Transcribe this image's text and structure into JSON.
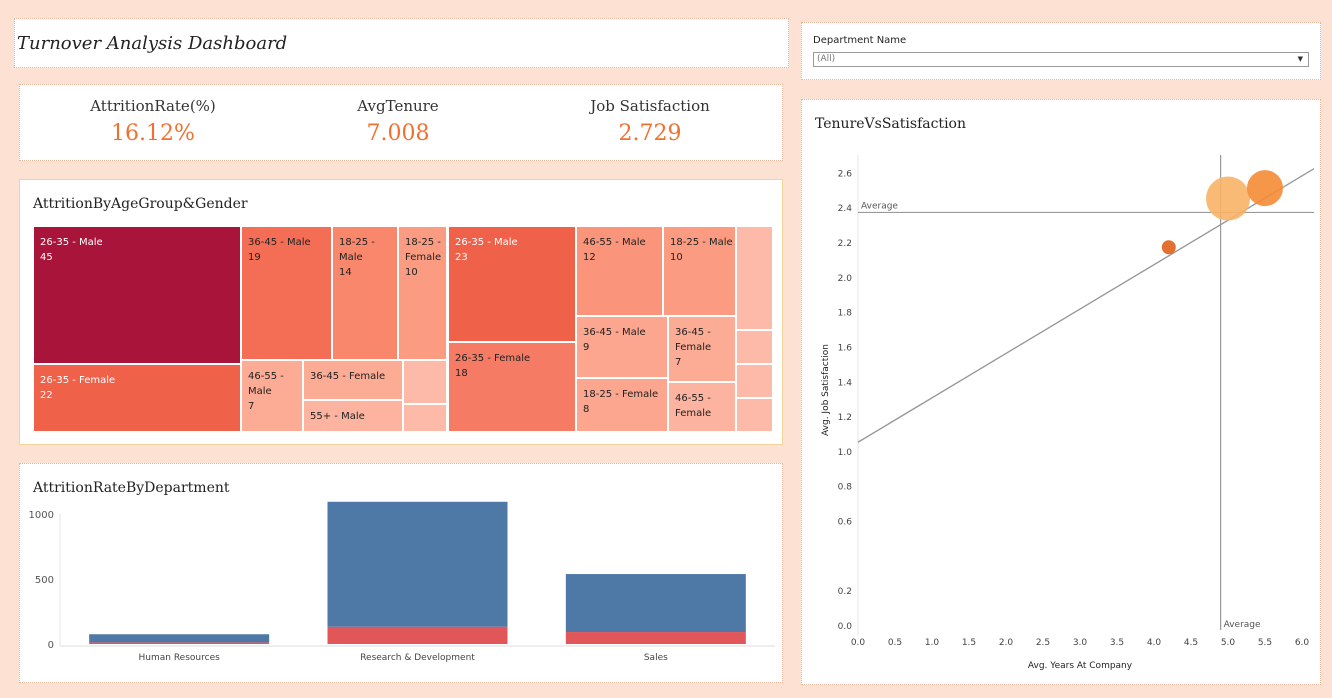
{
  "header": {
    "title": "Turnover Analysis Dashboard"
  },
  "filter": {
    "label": "Department Name",
    "value": "(All)"
  },
  "kpis": [
    {
      "label": "AttritionRate(%)",
      "value": "16.12%"
    },
    {
      "label": "AvgTenure",
      "value": "7.008"
    },
    {
      "label": "Job Satisfaction",
      "value": "2.729"
    }
  ],
  "treemap": {
    "title": "AttritionByAgeGroup&Gender",
    "cells": [
      {
        "label": "26-35 - Male",
        "value": "45",
        "color": "#a8143a"
      },
      {
        "label": "26-35 - Female",
        "value": "22",
        "color": "#f0614a"
      },
      {
        "label": "36-45 - Male",
        "value": "19",
        "color": "#f46d55"
      },
      {
        "label": "18-25 - Male",
        "value": "14",
        "color": "#f8876c"
      },
      {
        "label": "18-25 - Female",
        "value": "10",
        "color": "#fb9c82"
      },
      {
        "label": "46-55 - Male",
        "value": "7",
        "color": "#fcab95"
      },
      {
        "label": "36-45 - Female",
        "value": "",
        "color": "#fcab95"
      },
      {
        "label": "55+ - Male",
        "value": "",
        "color": "#fcb3a0"
      },
      {
        "label": "26-35 - Male",
        "value": "23",
        "color": "#f0614a"
      },
      {
        "label": "26-35 - Female",
        "value": "18",
        "color": "#f67b64"
      },
      {
        "label": "46-55 - Male",
        "value": "12",
        "color": "#fa957c"
      },
      {
        "label": "18-25 - Male",
        "value": "10",
        "color": "#fb9c82"
      },
      {
        "label": "36-45 - Male",
        "value": "9",
        "color": "#fca68f"
      },
      {
        "label": "36-45 - Female",
        "value": "7",
        "color": "#fcab95"
      },
      {
        "label": "18-25 - Female",
        "value": "8",
        "color": "#fca68f"
      },
      {
        "label": "46-55 - Female",
        "value": "",
        "color": "#fcb3a0"
      }
    ]
  },
  "chart_data": [
    {
      "type": "bar",
      "title": "AttritionRateByDepartment",
      "categories": [
        "Human Resources",
        "Research & Development",
        "Sales"
      ],
      "series": [
        {
          "values": [
            63,
            961,
            446
          ],
          "color": "#4e79a7"
        },
        {
          "values": [
            12,
            133,
            92
          ],
          "color": "#e15759"
        }
      ],
      "yticks": [
        "1000",
        "500",
        "0"
      ],
      "ylim": [
        0,
        1000
      ]
    },
    {
      "type": "scatter",
      "title": "TenureVsSatisfaction",
      "xlabel": "Avg. Years At Company",
      "ylabel": "Avg. Job Satisfaction",
      "xticks": [
        "0.0",
        "0.5",
        "1.0",
        "1.5",
        "2.0",
        "2.5",
        "3.0",
        "3.5",
        "4.0",
        "4.5",
        "5.0",
        "5.5",
        "6.0"
      ],
      "yticks": [
        "0.0",
        "0.2",
        "0.6",
        "0.8",
        "1.0",
        "1.2",
        "1.4",
        "1.6",
        "1.8",
        "2.0",
        "2.2",
        "2.4",
        "2.6"
      ],
      "points": [
        {
          "x": 4.2,
          "y": 2.17,
          "size": 7,
          "color": "#e0601a"
        },
        {
          "x": 5.0,
          "y": 2.45,
          "size": 22,
          "color": "#f7b266"
        },
        {
          "x": 5.5,
          "y": 2.51,
          "size": 18,
          "color": "#f58b34"
        }
      ],
      "reference_lines": {
        "x_label": "Average",
        "y_label": "Average",
        "x_avg": 4.9,
        "y_avg": 2.37
      },
      "trend": {
        "start": [
          0.0,
          1.05
        ],
        "end": [
          6.0,
          2.58
        ]
      }
    }
  ]
}
